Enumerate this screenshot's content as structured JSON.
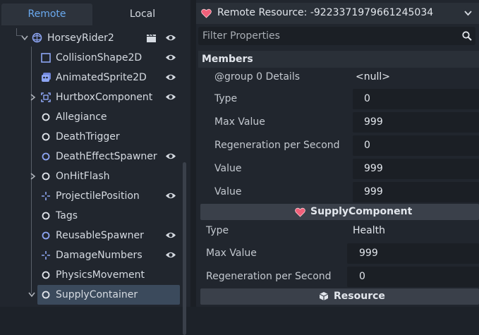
{
  "left_panel": {
    "tabs": {
      "remote": "Remote",
      "local": "Local"
    },
    "tree": [
      {
        "label": "HorseyRider2",
        "icon": "node-2d-icon",
        "has_scene": true,
        "visible_toggle": true
      },
      {
        "label": "CollisionShape2D",
        "icon": "collision-shape-icon",
        "visible_toggle": true
      },
      {
        "label": "AnimatedSprite2D",
        "icon": "animated-sprite-icon",
        "visible_toggle": true
      },
      {
        "label": "HurtboxComponent",
        "icon": "area-2d-icon",
        "expandable": true,
        "visible_toggle": true
      },
      {
        "label": "Allegiance",
        "icon": "node-icon"
      },
      {
        "label": "DeathTrigger",
        "icon": "node-icon"
      },
      {
        "label": "DeathEffectSpawner",
        "icon": "node-blue-icon",
        "visible_toggle": true
      },
      {
        "label": "OnHitFlash",
        "icon": "node-icon",
        "expandable": true
      },
      {
        "label": "ProjectilePosition",
        "icon": "marker-2d-icon",
        "visible_toggle": true
      },
      {
        "label": "Tags",
        "icon": "node-icon"
      },
      {
        "label": "ReusableSpawner",
        "icon": "node-blue-icon",
        "visible_toggle": true
      },
      {
        "label": "DamageNumbers",
        "icon": "marker-2d-icon",
        "visible_toggle": true
      },
      {
        "label": "PhysicsMovement",
        "icon": "node-icon"
      },
      {
        "label": "SupplyContainer",
        "icon": "node-icon",
        "selected": true
      }
    ]
  },
  "right_panel": {
    "header": {
      "title": "Remote Resource: -9223371979661245034",
      "icon": "heart-icon"
    },
    "filter": {
      "placeholder": "Filter Properties",
      "value": ""
    },
    "members_label": "Members",
    "group_props": [
      {
        "label": "@group 0 Details",
        "value": "<null>"
      },
      {
        "label": "Type",
        "value": "0"
      },
      {
        "label": "Max Value",
        "value": "999"
      },
      {
        "label": "Regeneration per Second",
        "value": "0"
      },
      {
        "label": "Value",
        "value": "999"
      },
      {
        "label": "Value",
        "value": "999"
      }
    ],
    "supply_section": "SupplyComponent",
    "supply_props": [
      {
        "label": "Type",
        "value": "Health"
      },
      {
        "label": "Max Value",
        "value": "999"
      },
      {
        "label": "Regeneration per Second",
        "value": "0"
      }
    ],
    "resource_section": "Resource"
  },
  "colors": {
    "accent": "#6aaaf0",
    "heart": "#f0607a",
    "selection": "#3b4a5c"
  }
}
